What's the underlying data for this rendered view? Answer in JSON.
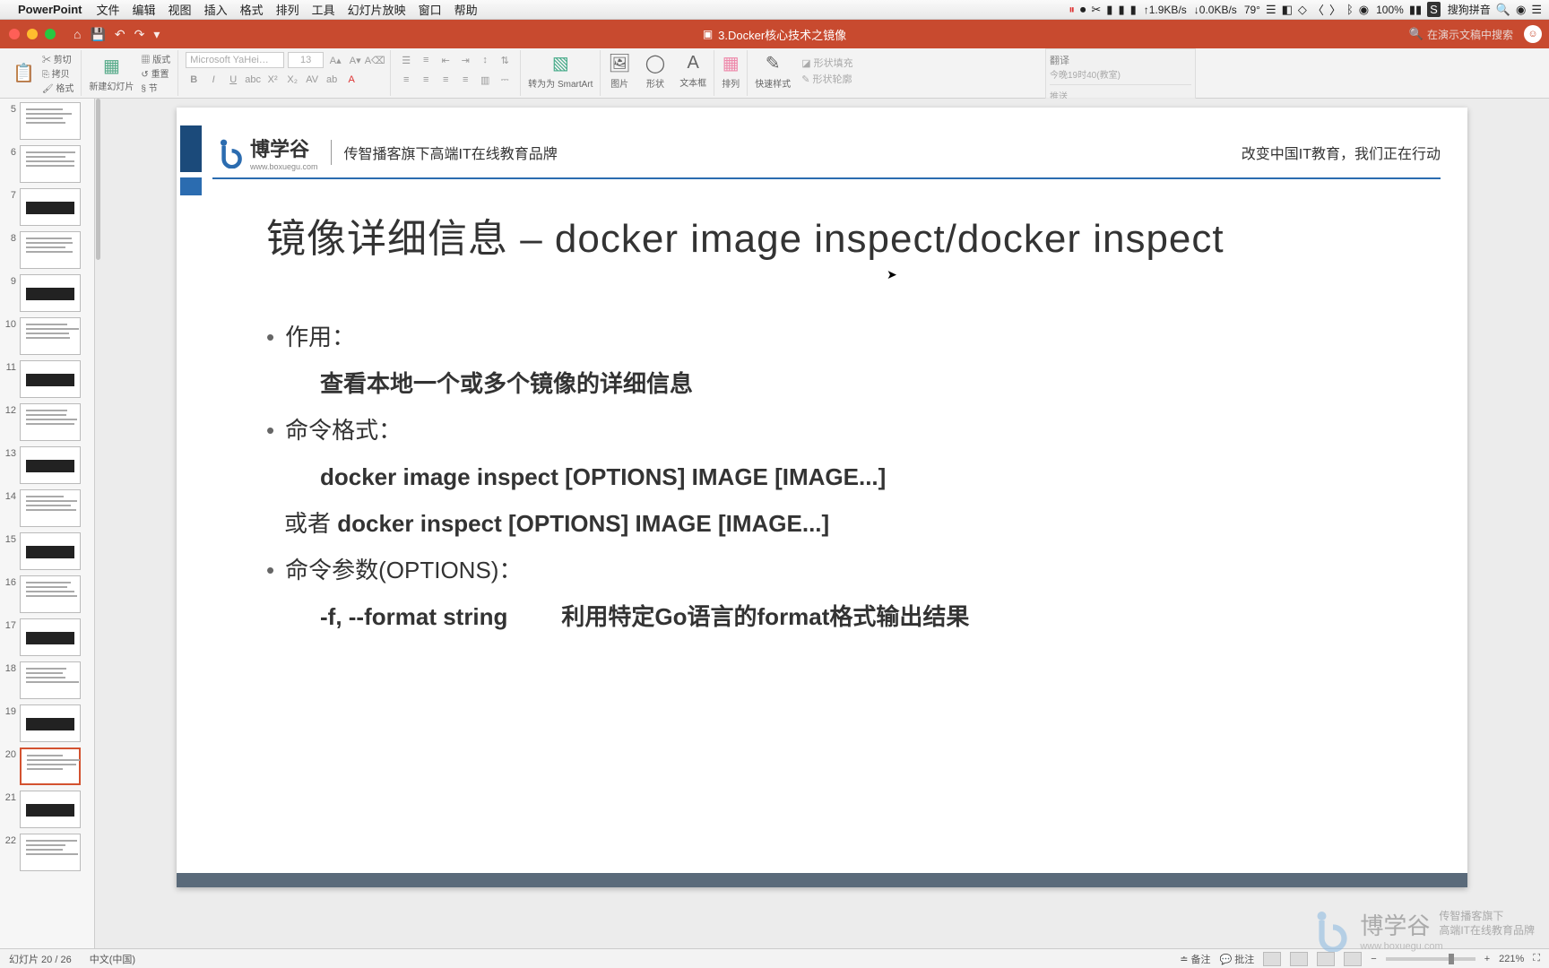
{
  "menubar": {
    "app": "PowerPoint",
    "file": "文件",
    "edit": "编辑",
    "view": "视图",
    "insert": "插入",
    "format": "格式",
    "arrange": "排列",
    "tools": "工具",
    "slideshow": "幻灯片放映",
    "window": "窗口",
    "help": "帮助",
    "net_up": "1.9KB/s",
    "net_down": "0.0KB/s",
    "temp": "79°",
    "battery": "100%",
    "ime": "搜狗拼音"
  },
  "titlebar": {
    "doc": "3.Docker核心技术之镜像",
    "search_placeholder": "在演示文稿中搜索"
  },
  "ribbon": {
    "paste": "粘贴",
    "cut": "剪切",
    "copy": "拷贝",
    "format_painter": "格式",
    "new_slide": "新建幻灯片",
    "layout": "版式",
    "reset": "重置",
    "section": "节",
    "font_name": "Microsoft YaHei…",
    "font_size": "13",
    "smartart": "转为为 SmartArt",
    "picture": "图片",
    "shapes": "形状",
    "textbox": "文本框",
    "arrange_btn": "排列",
    "quick_styles": "快速样式",
    "shape_fill": "形状填充",
    "shape_outline": "形状轮廓"
  },
  "thumbs": {
    "start": 5,
    "count": 18,
    "selected": 20,
    "dark_slides": [
      7,
      9,
      11,
      13,
      15,
      17,
      19,
      21
    ]
  },
  "slide": {
    "logo_text": "博学谷",
    "logo_url": "www.boxuegu.com",
    "brand_tagline": "传智播客旗下高端IT在线教育品牌",
    "brand_right": "改变中国IT教育，我们正在行动",
    "title": "镜像详细信息 – docker image inspect/docker inspect",
    "b1": "作用：",
    "b1_sub": "查看本地一个或多个镜像的详细信息",
    "b2": "命令格式：",
    "b2_sub1": "docker image inspect [OPTIONS] IMAGE [IMAGE...]",
    "b2_sub2_prefix": "或者 ",
    "b2_sub2": "docker inspect [OPTIONS] IMAGE [IMAGE...]",
    "b3": "命令参数(OPTIONS)：",
    "b3_param": "-f, --format string",
    "b3_desc": "利用特定Go语言的format格式输出结果"
  },
  "watermark": {
    "name": "博学谷",
    "line1": "传智播客旗下",
    "line2": "高端IT在线教育品牌",
    "url": "www.boxuegu.com"
  },
  "statusbar": {
    "slide_of": "幻灯片 20 / 26",
    "lang": "中文(中国)",
    "notes": "备注",
    "comments": "批注",
    "zoom": "221%"
  }
}
